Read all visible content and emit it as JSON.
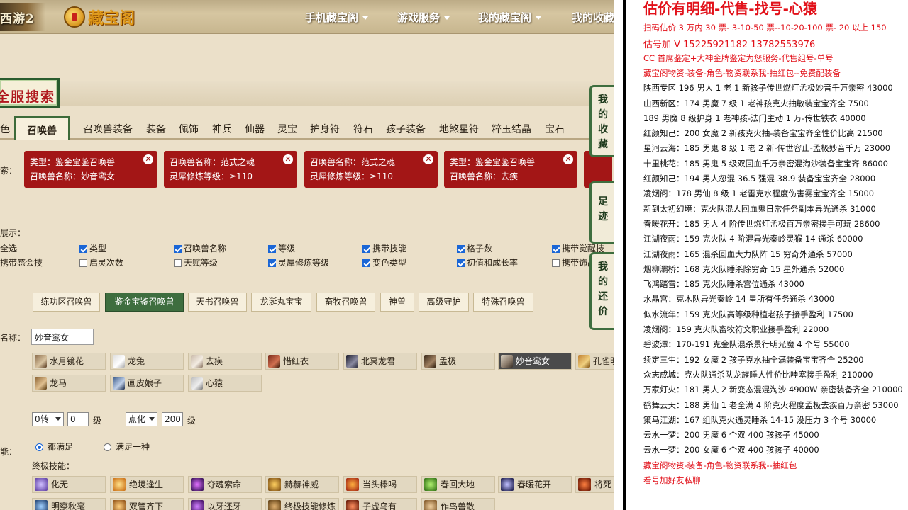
{
  "header": {
    "game_logo": "西游2",
    "site_logo": "藏宝阁",
    "nav": [
      "手机藏宝阁",
      "游戏服务",
      "我的藏宝阁",
      "我的收藏"
    ]
  },
  "search": {
    "banner": "全服搜索",
    "tabs": [
      "色",
      "召唤兽",
      "召唤兽装备",
      "装备",
      "佩饰",
      "神兵",
      "仙器",
      "灵宝",
      "护身符",
      "符石",
      "孩子装备",
      "地煞星符",
      "粹玉结晶",
      "宝石"
    ],
    "active_tab": "召唤兽",
    "filters_label": "索：",
    "chips": [
      {
        "line1": "类型：鉴金宝鉴召唤兽",
        "line2": "召唤兽名称：妙音鸾女"
      },
      {
        "line1": "召唤兽名称：范式之魂",
        "line2": "灵犀修炼等级：≥110"
      },
      {
        "line1": "召唤兽名称：范式之魂",
        "line2": "灵犀修炼等级：≥110"
      },
      {
        "line1": "类型：鉴金宝鉴召唤兽",
        "line2": "召唤兽名称：去疾"
      }
    ],
    "display_label": "展示：",
    "checkboxes": [
      {
        "label": "全选",
        "checked": false
      },
      {
        "label": "类型",
        "checked": true
      },
      {
        "label": "召唤兽名称",
        "checked": true
      },
      {
        "label": "等级",
        "checked": true
      },
      {
        "label": "携带技能",
        "checked": true
      },
      {
        "label": "格子数",
        "checked": true
      },
      {
        "label": "携带觉醒技",
        "checked": true
      },
      {
        "label": "携带感会技",
        "checked": false
      },
      {
        "label": "启灵次数",
        "checked": false
      },
      {
        "label": "天赋等级",
        "checked": false
      },
      {
        "label": "灵犀修炼等级",
        "checked": true
      },
      {
        "label": "变色类型",
        "checked": true
      },
      {
        "label": "初值和成长率",
        "checked": true
      },
      {
        "label": "携带饰品",
        "checked": false
      }
    ],
    "categories": [
      "练功区召唤兽",
      "鉴金宝鉴召唤兽",
      "天书召唤兽",
      "龙涎丸宝宝",
      "畜牧召唤兽",
      "神兽",
      "高级守护",
      "特殊召唤兽"
    ],
    "active_category": "鉴金宝鉴召唤兽",
    "name_label": "名称：",
    "name_value": "妙音鸾女",
    "pets": [
      "水月镜花",
      "龙兔",
      "去疾",
      "惜红衣",
      "北冥龙君",
      "孟极",
      "妙音鸾女",
      "孔雀明",
      "龙马",
      "画皮娘子",
      "心猿"
    ],
    "active_pet": "妙音鸾女",
    "level": {
      "turn": "0转",
      "min": "0",
      "unit1": "级 ——",
      "form": "点化",
      "max": "200",
      "unit2": "级"
    },
    "skill_label": "能：",
    "skill_options": [
      {
        "label": "都满足",
        "checked": true
      },
      {
        "label": "满足一种",
        "checked": false
      }
    ],
    "ult_label": "终极技能：",
    "skills_row1": [
      "化无",
      "绝境逢生",
      "夺魂索命",
      "赫赫神威",
      "当头棒喝",
      "春回大地",
      "春暖花开",
      "将死"
    ],
    "skills_row2": [
      "明察秋毫",
      "双管齐下",
      "以牙还牙",
      "终极技能修炼",
      "子虚乌有",
      "作鸟兽散"
    ],
    "side_tabs": [
      "我的收藏",
      "足迹",
      "我的还价"
    ]
  },
  "notes": {
    "headline": "估价有明细-代售-找号-心猿",
    "lines": [
      {
        "text": "扫码估价 3 万内 30 票- 3-10-50 票--10-20-100 票- 20 以上 150",
        "red": true
      },
      {
        "text": "估号加 V 15225921182   13782553976",
        "red": true
      },
      {
        "text": "CC 首席鉴定+大神金牌鉴定为您服务-代售组号-单号",
        "red": true
      },
      {
        "text": "藏宝阁物资-装备-角色-物资联系我-抽红包--免费配装备",
        "red": true
      },
      {
        "text": "陕西专区 196 男人 1 老 1 新孩子传世燃灯孟极妙音千万亲密 43000",
        "red": false
      },
      {
        "text": "山西新区：174 男魔 7 级 1 老神孩克火抽敏装宝宝齐全 7500",
        "red": false
      },
      {
        "text": "189 男魔 8 级护身 1 老神孩-法门主动 1 万-传世铁衣 40000",
        "red": false
      },
      {
        "text": "红颜知己：200 女魔 2 新孩克火抽-装备宝宝齐全性价比高 21500",
        "red": false
      },
      {
        "text": "星河云海：185 男鬼 8 级 1 老 2 新-传世容止-孟极妙音千万 23000",
        "red": false
      },
      {
        "text": "十里桃花：185 男鬼 5 级双回血千万亲密混淘沙装备宝宝齐 86000",
        "red": false
      },
      {
        "text": "红颜知己：194 男人忽混 36.5 强混 38.9 装备宝宝齐全 28000",
        "red": false
      },
      {
        "text": "凌烟阁：178 男仙 8 级 1 老雷克水程度伤害雾宝宝齐全 15000",
        "red": false
      },
      {
        "text": "新到太初幻境：克火队混人回血鬼日常任务副本异光通杀 31000",
        "red": false
      },
      {
        "text": "春暖花开：185 男人 4 阶传世燃灯孟极百万亲密接手可玩 28600",
        "red": false
      },
      {
        "text": "江湖夜雨：159 克火队 4 阶混异光秦岭灵猴 14 通杀 60000",
        "red": false
      },
      {
        "text": "江湖夜雨：165 混杀回血大力队阵 15 穷奇外通杀 57000",
        "red": false
      },
      {
        "text": "烟柳灞桥：168 克火队睡杀除穷奇 15 星外通杀 52000",
        "red": false
      },
      {
        "text": "飞鸿踏雪：185 克火队睡杀宫位通杀 43000",
        "red": false
      },
      {
        "text": "水晶宫：克木队异光秦岭 14 星所有任务通杀 43000",
        "red": false
      },
      {
        "text": "似水流年：159 克火队高等级种植老孩子接手盈利 17500",
        "red": false
      },
      {
        "text": "凌烟阁：159 克火队畜牧符文职业接手盈利 22000",
        "red": false
      },
      {
        "text": "碧波潭：170-191 克金队混杀景行明光魔 4 个号 55000",
        "red": false
      },
      {
        "text": "续定三生：192 女魔 2 孩子克水抽全满装备宝宝齐全 25200",
        "red": false
      },
      {
        "text": "众志成城：克火队通杀队龙族睡人性价比哇塞接手盈利 210000",
        "red": false
      },
      {
        "text": "万家灯火：181 男人 2 新变态混混淘沙 4900W 亲密装备齐全 210000",
        "red": false
      },
      {
        "text": "鹤舞云天：188 男仙 1 老全满 4 阶克火程度孟极去疾百万亲密 53000",
        "red": false
      },
      {
        "text": "策马江湖：167 组队克火通灵睡杀 14-15 没压力 3 个号 30000",
        "red": false
      },
      {
        "text": "云水一梦：200 男魔 6 个双 400 孩孩子 45000",
        "red": false
      },
      {
        "text": "云水一梦：200 女魔 6 个双 400 孩孩子 40000",
        "red": false
      },
      {
        "text": "藏宝阁物资-装备-角色-物资联系我--抽红包",
        "red": true
      },
      {
        "text": "看号加好友私聊",
        "red": true
      }
    ]
  },
  "colors": {
    "accent_red": "#a31616",
    "note_red": "#e2111a",
    "green": "#3e6e3f"
  }
}
